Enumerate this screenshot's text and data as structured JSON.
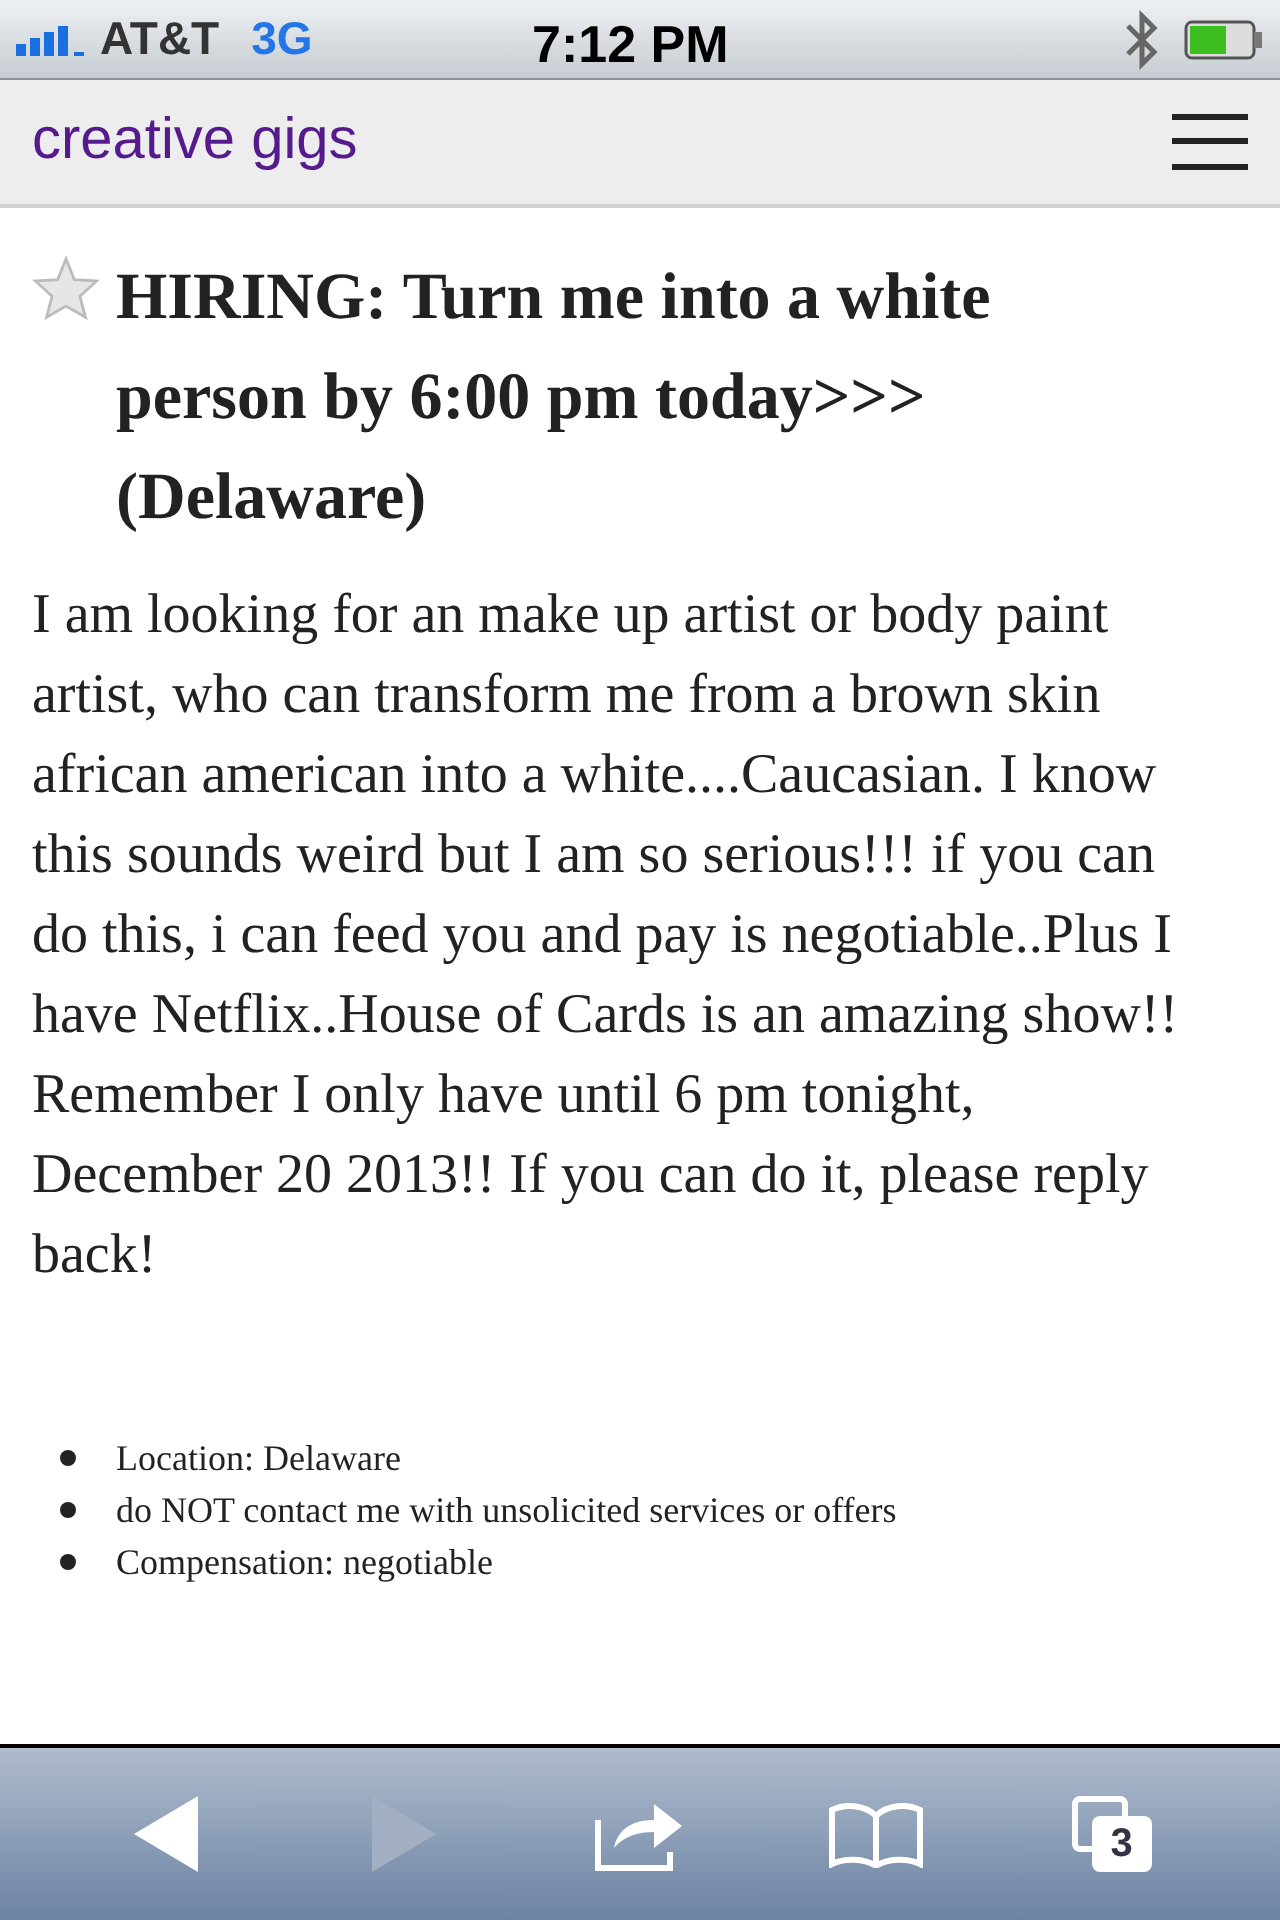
{
  "status_bar": {
    "carrier": "AT&T",
    "network": "3G",
    "time": "7:12 PM"
  },
  "header": {
    "title": "creative gigs"
  },
  "post": {
    "starred": false,
    "title": "HIRING: Turn me into a white person by 6:00 pm today>>> (Delaware)",
    "body": "I am looking for an make up artist or body paint artist, who can transform me from a brown skin african american into a white....Caucasian. I know this sounds weird but I am so serious!!! if you can do this, i can feed you and pay is negotiable..Plus I have Netflix..House of Cards is an amazing show!! Remember I only have until 6 pm tonight, December 20 2013!! If you can do it, please reply back!"
  },
  "attributes": [
    "Location: Delaware",
    "do NOT contact me with unsolicited services or offers",
    "Compensation: negotiable"
  ],
  "toolbar": {
    "buttons": [
      {
        "kind": "back",
        "disabled": false
      },
      {
        "kind": "forward",
        "disabled": true
      },
      {
        "kind": "share",
        "disabled": false
      },
      {
        "kind": "bookmarks",
        "disabled": false
      },
      {
        "kind": "tabs",
        "disabled": false,
        "badge": "3"
      }
    ]
  }
}
